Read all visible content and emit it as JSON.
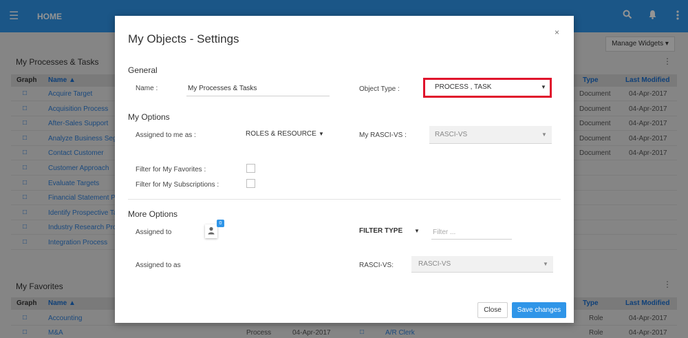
{
  "topbar": {
    "menu_icon": "hamburger-icon",
    "title": "HOME",
    "icons": [
      "search-icon",
      "bell-icon",
      "kebab-icon"
    ]
  },
  "processes_widget": {
    "title": "My Processes & Tasks",
    "manage_label": "Manage Widgets",
    "columns": {
      "graph": "Graph",
      "name": "Name",
      "type": "Type",
      "last_modified": "Last Modified"
    },
    "rows": [
      {
        "name": "Acquire Target",
        "type": "Document",
        "date": "04-Apr-2017"
      },
      {
        "name": "Acquisition Process",
        "type": "Document",
        "date": "04-Apr-2017"
      },
      {
        "name": "After-Sales Support",
        "type": "Document",
        "date": "04-Apr-2017"
      },
      {
        "name": "Analyze Business Seg",
        "type": "Document",
        "date": "04-Apr-2017"
      },
      {
        "name": "Contact Customer",
        "type": "Document",
        "date": "04-Apr-2017"
      },
      {
        "name": "Customer Approach",
        "type": "",
        "date": ""
      },
      {
        "name": "Evaluate Targets",
        "type": "",
        "date": ""
      },
      {
        "name": "Financial Statement P",
        "type": "",
        "date": ""
      },
      {
        "name": "Identify Prospective Ta",
        "type": "",
        "date": ""
      },
      {
        "name": "Industry Research Pro",
        "type": "",
        "date": ""
      },
      {
        "name": "Integration Process",
        "type": "",
        "date": ""
      }
    ]
  },
  "favorites_widget": {
    "title": "My Favorites",
    "columns": {
      "graph": "Graph",
      "name": "Name",
      "type": "Type",
      "last_modified": "Last Modified"
    },
    "rows": [
      {
        "name": "Accounting",
        "mid_type": "",
        "mid_date": "",
        "mid_name": "",
        "type": "Role",
        "date": "04-Apr-2017"
      },
      {
        "name": "M&A",
        "mid_type": "Process",
        "mid_date": "04-Apr-2017",
        "mid_name": "A/R Clerk",
        "type": "Role",
        "date": "04-Apr-2017"
      }
    ]
  },
  "modal": {
    "title": "My Objects - Settings",
    "general": {
      "heading": "General",
      "name_label": "Name :",
      "name_value": "My Processes & Tasks",
      "object_type_label": "Object Type :",
      "object_type_value": "PROCESS , TASK"
    },
    "my_options": {
      "heading": "My Options",
      "assigned_label": "Assigned to me as :",
      "assigned_value": "ROLES & RESOURCE",
      "rasci_label": "My RASCI-VS :",
      "rasci_value": "RASCI-VS",
      "favorites_label": "Filter for My Favorites :",
      "subscriptions_label": "Filter for My Subscriptions :"
    },
    "more_options": {
      "heading": "More Options",
      "assigned_to_label": "Assigned to",
      "badge_count": "0",
      "filter_type_value": "FILTER TYPE",
      "filter_placeholder": "Filter ...",
      "assigned_as_label": "Assigned to as",
      "rasci_label": "RASCI-VS:",
      "rasci_value": "RASCI-VS"
    },
    "close_label": "Close",
    "save_label": "Save changes"
  },
  "colors": {
    "primary": "#2f95e8",
    "highlight": "#e0112b",
    "link": "#2f7fd8"
  }
}
